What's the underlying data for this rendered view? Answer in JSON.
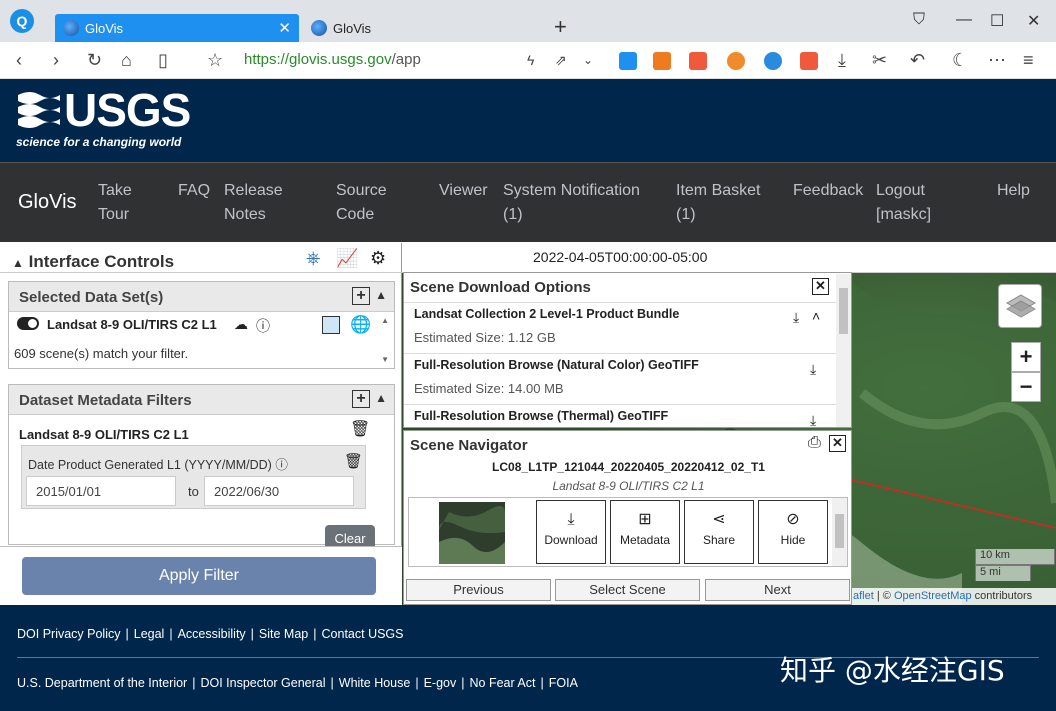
{
  "browser": {
    "logo": "Q",
    "tabs": [
      {
        "label": "GloVis",
        "active": true
      },
      {
        "label": "GloVis",
        "active": false
      }
    ],
    "new_tab": "+",
    "url_secure": "https://",
    "url_host": "glovis.usgs.gov",
    "url_path": "/app",
    "window_controls": [
      "bookmark-bar-icon",
      "minimize-icon",
      "maximize-icon",
      "close-icon"
    ]
  },
  "usgs": {
    "wordmark": "USGS",
    "tagline": "science for a changing world"
  },
  "glovis_nav": {
    "brand": "GloVis",
    "links": [
      {
        "line1": "Take",
        "line2": "Tour"
      },
      {
        "line1": "FAQ",
        "line2": ""
      },
      {
        "line1": "Release",
        "line2": "Notes"
      },
      {
        "line1": "Source",
        "line2": "Code"
      },
      {
        "line1": "Viewer",
        "line2": ""
      },
      {
        "line1": "System Notification",
        "line2": "(1)"
      },
      {
        "line1": "Item Basket",
        "line2": "(1)"
      },
      {
        "line1": "Feedback",
        "line2": ""
      },
      {
        "line1": "Logout",
        "line2": "[maskc]"
      },
      {
        "line1": "Help",
        "line2": ""
      }
    ]
  },
  "interface_controls": {
    "title": "Interface Controls",
    "selected_datasets": {
      "title": "Selected Data Set(s)",
      "dataset_name": "Landsat 8-9 OLI/TIRS C2 L1",
      "match_count": "609 scene(s) match your filter."
    },
    "metadata_filters": {
      "title": "Dataset Metadata Filters",
      "dataset_name": "Landsat 8-9 OLI/TIRS C2 L1",
      "filter_label": "Date Product Generated L1 (YYYY/MM/DD)",
      "from_value": "2015/01/01",
      "to_label": "to",
      "to_value": "2022/06/30",
      "clear_label": "Clear"
    },
    "apply_label": "Apply Filter"
  },
  "map": {
    "date": "2022-04-05T00:00:00-05:00",
    "zoom_in": "+",
    "zoom_out": "−",
    "scale_km": "10 km",
    "scale_mi": "5 mi",
    "attribution_leaflet": "aflet",
    "attribution_sep": " | © ",
    "attribution_osm": "OpenStreetMap",
    "attribution_rest": " contributors"
  },
  "download_options": {
    "title": "Scene Download Options",
    "items": [
      {
        "title": "Landsat Collection 2 Level-1 Product Bundle",
        "size": "Estimated Size: 1.12 GB"
      },
      {
        "title": "Full-Resolution Browse (Natural Color) GeoTIFF",
        "size": "Estimated Size: 14.00 MB"
      },
      {
        "title": "Full-Resolution Browse (Thermal) GeoTIFF",
        "size": ""
      }
    ]
  },
  "scene_navigator": {
    "title": "Scene Navigator",
    "scene_id": "LC08_L1TP_121044_20220405_20220412_02_T1",
    "dataset": "Landsat 8-9 OLI/TIRS C2 L1",
    "actions": [
      "Download",
      "Metadata",
      "Share",
      "Hide"
    ],
    "previous": "Previous",
    "select": "Select Scene",
    "next": "Next"
  },
  "footer": {
    "row1": [
      "DOI Privacy Policy",
      "Legal",
      "Accessibility",
      "Site Map",
      "Contact USGS"
    ],
    "row2": [
      "U.S. Department of the Interior",
      "DOI Inspector General",
      "White House",
      "E-gov",
      "No Fear Act",
      "FOIA"
    ],
    "watermark": "知乎 @水经注GIS"
  },
  "colors": {
    "usgs_navy": "#00264c",
    "nav_dark": "#303133",
    "tab_active": "#1e90f0",
    "apply_button": "#6a83ad",
    "url_green": "#2a8a2a"
  }
}
